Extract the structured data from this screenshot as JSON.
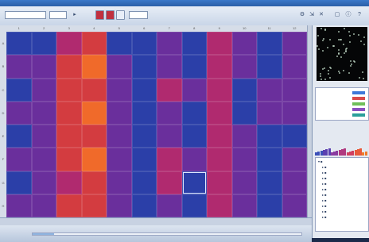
{
  "toolbar": {
    "combo_left": "",
    "combo_mid": "",
    "combo_right": ""
  },
  "plate": {
    "columns": [
      "1",
      "2",
      "3",
      "4",
      "5",
      "6",
      "7",
      "8",
      "9",
      "10",
      "11",
      "12"
    ],
    "rows": [
      "A",
      "B",
      "C",
      "D",
      "E",
      "F",
      "G",
      "H"
    ],
    "selected_well": "G8",
    "colors": {
      "blue": "#2b3fa8",
      "purple": "#6a2f9c",
      "magenta": "#b02a6f",
      "red": "#d33c40",
      "orange": "#f06a2a"
    },
    "wells": [
      [
        "blue",
        "blue",
        "magenta",
        "red",
        "blue",
        "blue",
        "purple",
        "blue",
        "magenta",
        "purple",
        "blue",
        "purple"
      ],
      [
        "purple",
        "purple",
        "red",
        "orange",
        "purple",
        "blue",
        "purple",
        "blue",
        "magenta",
        "purple",
        "blue",
        "purple"
      ],
      [
        "blue",
        "purple",
        "red",
        "red",
        "purple",
        "blue",
        "magenta",
        "purple",
        "magenta",
        "blue",
        "purple",
        "purple"
      ],
      [
        "purple",
        "purple",
        "red",
        "orange",
        "purple",
        "blue",
        "purple",
        "blue",
        "magenta",
        "blue",
        "purple",
        "purple"
      ],
      [
        "blue",
        "purple",
        "red",
        "red",
        "purple",
        "blue",
        "purple",
        "blue",
        "magenta",
        "purple",
        "blue",
        "blue"
      ],
      [
        "purple",
        "purple",
        "red",
        "orange",
        "purple",
        "blue",
        "magenta",
        "purple",
        "magenta",
        "purple",
        "blue",
        "purple"
      ],
      [
        "blue",
        "purple",
        "magenta",
        "red",
        "purple",
        "blue",
        "magenta",
        "blue",
        "magenta",
        "purple",
        "blue",
        "purple"
      ],
      [
        "purple",
        "purple",
        "red",
        "red",
        "purple",
        "blue",
        "purple",
        "blue",
        "magenta",
        "purple",
        "blue",
        "purple"
      ]
    ]
  },
  "legend": {
    "items": [
      {
        "label": "",
        "color": "#3d78d8"
      },
      {
        "label": "",
        "color": "#d84a4a"
      },
      {
        "label": "",
        "color": "#6fbf5a"
      },
      {
        "label": "",
        "color": "#8a4fc0"
      },
      {
        "label": "",
        "color": "#2a9f9a"
      }
    ]
  },
  "histogram": {
    "colors": [
      "#3b4fb8",
      "#5a3fb0",
      "#8a3aa0",
      "#b03a80",
      "#d04060",
      "#e85a3a",
      "#f07a2a"
    ]
  },
  "progress": 0.08
}
